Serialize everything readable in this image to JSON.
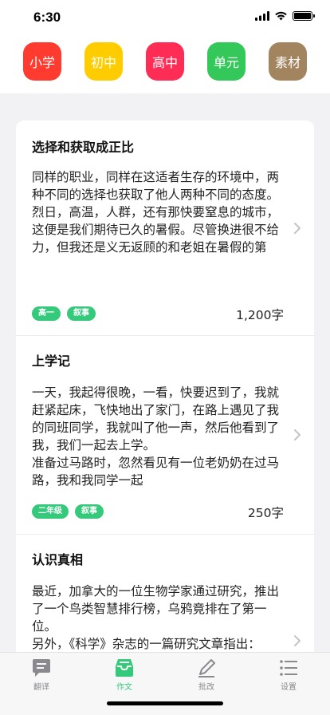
{
  "status_bar": {
    "time": "6:30"
  },
  "categories": [
    {
      "label": "小学",
      "color": "#ff3b30"
    },
    {
      "label": "初中",
      "color": "#ffcc00"
    },
    {
      "label": "高中",
      "color": "#ff2d55"
    },
    {
      "label": "单元",
      "color": "#34c759"
    },
    {
      "label": "素材",
      "color": "#a2845e"
    }
  ],
  "articles": [
    {
      "title": "选择和获取成正比",
      "body": "同样的职业，同样在这适者生存的环境中，两种不同的选择也获取了他人两种不同的态度。\n烈日，高温，人群，还有那快要窒息的城市，这便是我们期待已久的暑假。尽管换进很不给力，但我还是义无返顾的和老姐在暑假的第",
      "tags": [
        "高一",
        "叙事"
      ],
      "word_count": "1,200字"
    },
    {
      "title": "上学记",
      "body": "一天，我起得很晚，一看，快要迟到了，我就赶紧起床，飞快地出了家门，在路上遇见了我的同班同学，我就叫了他一声，然后他看到了我，我们一起去上学。\n准备过马路时，忽然看见有一位老奶奶在过马路，我和我同学一起",
      "tags": [
        "二年级",
        "叙事"
      ],
      "word_count": "250字"
    },
    {
      "title": "认识真相",
      "body": "最近，加拿大的一位生物学家通过研究，推出了一个鸟类智慧排行榜，乌鸦竟排在了第一位。\n另外，《科学》杂志的一篇研究文章指出：",
      "tags": [],
      "word_count": ""
    }
  ],
  "tab_bar": {
    "items": [
      {
        "label": "翻译",
        "icon": "chat-bubble-icon"
      },
      {
        "label": "作文",
        "icon": "tray-icon"
      },
      {
        "label": "批改",
        "icon": "pencil-icon"
      },
      {
        "label": "设置",
        "icon": "list-icon"
      }
    ],
    "active_index": 1,
    "accent_color": "#34c97b"
  }
}
